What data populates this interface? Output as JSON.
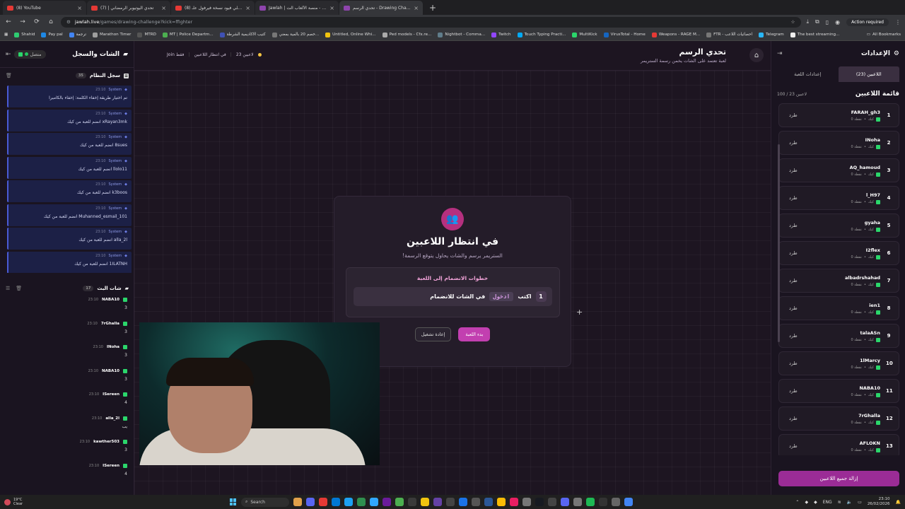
{
  "browser": {
    "tabs": [
      {
        "label": "(8) YouTube",
        "color": "#e53935",
        "active": false
      },
      {
        "label": "تحدي اليوتيوبر الرمضاني | (7)",
        "color": "#e53935",
        "active": false
      },
      {
        "label": "(8) فاملي فيود نسخة فيرفول علـ...",
        "color": "#e53935",
        "active": false
      },
      {
        "label": "Jawlah | جولة - منصة الألعاب الت...",
        "color": "#8e44ad",
        "active": false
      },
      {
        "label": "تحدي الرسم - Drawing Challenge",
        "color": "#8e44ad",
        "active": true
      }
    ],
    "url_host": "jawlah.live",
    "url_path": "/games/drawing-challenge?kick=ffighter",
    "action_required": "Action required",
    "bookmarks": [
      {
        "label": "Shahid",
        "color": "#2ecc71"
      },
      {
        "label": "Pay pal",
        "color": "#1e88e5"
      },
      {
        "label": "ترجمة",
        "color": "#4285f4"
      },
      {
        "label": "Marathon Timer",
        "color": "#9e9e9e"
      },
      {
        "label": "MTRD",
        "color": "#555555"
      },
      {
        "label": "MT | Police Departm...",
        "color": "#4caf50"
      },
      {
        "label": "كتيب الاكاديمية الشرطة",
        "color": "#3f51b5"
      },
      {
        "label": "خصم 20 بالمية بمعني...",
        "color": "#777777"
      },
      {
        "label": "Untitled, Online Whi...",
        "color": "#f1c40f"
      },
      {
        "label": "Ped models - Cfx.re...",
        "color": "#aaaaaa"
      },
      {
        "label": "Nightbot - Comma...",
        "color": "#607d8b"
      },
      {
        "label": "Twitch",
        "color": "#9146ff"
      },
      {
        "label": "Touch Typing Practi...",
        "color": "#03a9f4"
      },
      {
        "label": "MultiKick",
        "color": "#2bd66b"
      },
      {
        "label": "VirusTotal - Home",
        "color": "#1565c0"
      },
      {
        "label": "Weapons - RAGE M...",
        "color": "#e53935"
      },
      {
        "label": "FTR - احصائيات اللاعب",
        "color": "#777777"
      },
      {
        "label": "Telegram",
        "color": "#29b6f6"
      },
      {
        "label": "The best streaming...",
        "color": "#eeeeee"
      }
    ],
    "all_bookmarks": "All Bookmarks"
  },
  "left_panel": {
    "title": "الشات والسجل",
    "connection_status": "متصل",
    "system_log": {
      "title": "سجل النظام",
      "count": "35",
      "messages": [
        {
          "sender": "System",
          "time": "23:10",
          "text": "تم اختيار طريقة إخفاء الكلمة: إخفاء بالكاميرا"
        },
        {
          "sender": "System",
          "time": "23:10",
          "text": "xRayan3mk انضم للعبة من كيك"
        },
        {
          "sender": "System",
          "time": "23:10",
          "text": "8sues انضم للعبة من كيك"
        },
        {
          "sender": "System",
          "time": "23:10",
          "text": "llolo11 انضم للعبة من كيك"
        },
        {
          "sender": "System",
          "time": "23:10",
          "text": "k3boos انضم للعبة من كيك"
        },
        {
          "sender": "System",
          "time": "23:10",
          "text": "Muhanned_esmail_101 انضم للعبة من كيك"
        },
        {
          "sender": "System",
          "time": "23:10",
          "text": "alla_2l انضم للعبة من كيك"
        },
        {
          "sender": "System",
          "time": "23:10",
          "text": "1ILATNH انضم للعبة من كيك"
        }
      ]
    },
    "live_chat": {
      "title": "شات البث",
      "count": "17",
      "messages": [
        {
          "user": "NABA10",
          "time": "23:10",
          "text": "3"
        },
        {
          "user": "7rGhalla",
          "time": "23:10",
          "text": "3"
        },
        {
          "user": "INoha",
          "time": "23:10",
          "text": "3"
        },
        {
          "user": "NABA10",
          "time": "23:10",
          "text": "3"
        },
        {
          "user": "ISereen",
          "time": "23:10",
          "text": "4"
        },
        {
          "user": "alla_2l",
          "time": "23:10",
          "text": "يب"
        },
        {
          "user": "kawther503",
          "time": "23:10",
          "text": "3"
        },
        {
          "user": "ISereen",
          "time": "23:10",
          "text": "4"
        }
      ]
    }
  },
  "header": {
    "title": "تحدي الرسم",
    "subtitle": "لعبة تعتمد على الشات يخمن رسمة الستريمر",
    "players_count": "23 لاعبين",
    "phase": "في انتظار اللاعبين",
    "mode": "Join فقط"
  },
  "modal": {
    "title": "في انتظار اللاعبين",
    "subtitle": "الستريمر يرسم والشات يحاول يتوقع الرسمة!",
    "steps_title": "خطوات الانضمام إلى اللعبة",
    "step_number": "1",
    "step_prefix": "اكتب",
    "step_keyword": "ادخول",
    "step_suffix": "في الشات للانضمام",
    "start_button": "بدء اللعبة",
    "reset_button": "إعادة تشغيل"
  },
  "settings": {
    "title": "الإعدادات",
    "tabs": [
      {
        "label": "اللاعبين (23)",
        "active": true
      },
      {
        "label": "إعدادات اللعبة",
        "active": false
      }
    ],
    "list_title": "قائمة اللاعبين",
    "list_count": "100 / 23 لاعبين",
    "kick_label": "طرد",
    "platform_label": "كيك",
    "points_label": "0 نقطة",
    "players": [
      {
        "rank": "1",
        "name": "FARAH_gh3"
      },
      {
        "rank": "2",
        "name": "INoha"
      },
      {
        "rank": "3",
        "name": "AQ_hamoud"
      },
      {
        "rank": "4",
        "name": "l_H97"
      },
      {
        "rank": "5",
        "name": "gyaha"
      },
      {
        "rank": "6",
        "name": "I2flex"
      },
      {
        "rank": "7",
        "name": "albadrshahad"
      },
      {
        "rank": "8",
        "name": "ien1"
      },
      {
        "rank": "9",
        "name": "talaASn"
      },
      {
        "rank": "10",
        "name": "1lMarcy"
      },
      {
        "rank": "11",
        "name": "NABA10"
      },
      {
        "rank": "12",
        "name": "7rGhalla"
      },
      {
        "rank": "13",
        "name": "AFLOKN"
      }
    ],
    "remove_all": "إزالة جميع اللاعبين"
  },
  "taskbar": {
    "weather_temp": "19°C",
    "weather_desc": "Clear",
    "search": "Search",
    "language": "ENG",
    "time": "23:10",
    "date": "26/02/2026"
  },
  "colors": {
    "accent": "#c23fb0",
    "kick_green": "#2bd66b",
    "system_blue": "#4a5bd6"
  }
}
